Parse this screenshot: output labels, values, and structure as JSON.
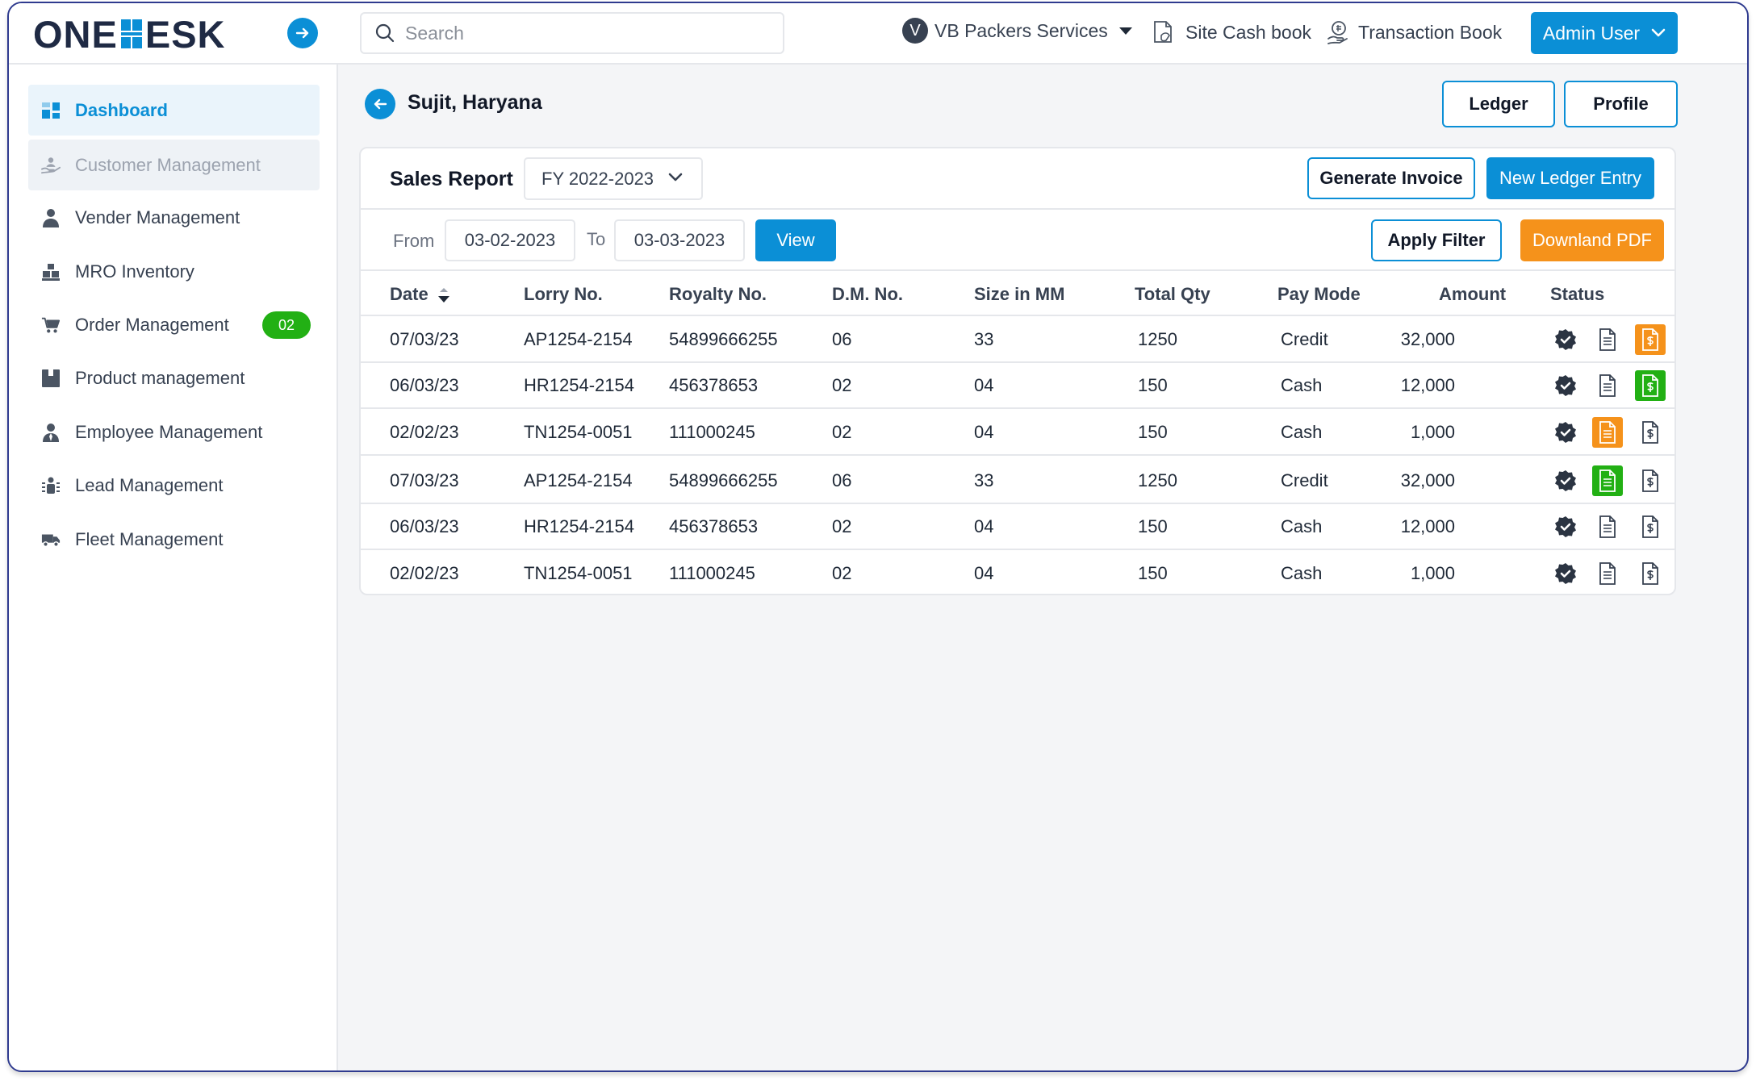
{
  "app": {
    "logo_text_left": "ONE",
    "logo_text_right": "ESK"
  },
  "header": {
    "search_placeholder": "Search",
    "company_initial": "V",
    "company_name": "VB Packers Services",
    "site_cash_book": "Site Cash book",
    "transaction_book": "Transaction Book",
    "admin_user": "Admin User"
  },
  "sidebar": {
    "items": [
      {
        "label": "Dashboard",
        "icon": "dashboard-icon",
        "state": "active"
      },
      {
        "label": "Customer Management",
        "icon": "customer-icon",
        "state": "hover"
      },
      {
        "label": "Vender Management",
        "icon": "person-icon",
        "state": "normal"
      },
      {
        "label": "MRO Inventory",
        "icon": "inventory-icon",
        "state": "normal"
      },
      {
        "label": "Order Management",
        "icon": "cart-icon",
        "state": "normal",
        "badge": "02"
      },
      {
        "label": "Product management",
        "icon": "product-icon",
        "state": "normal"
      },
      {
        "label": "Employee Management",
        "icon": "employee-icon",
        "state": "normal"
      },
      {
        "label": "Lead Management",
        "icon": "lead-icon",
        "state": "normal"
      },
      {
        "label": "Fleet Management",
        "icon": "truck-icon",
        "state": "normal"
      }
    ]
  },
  "page": {
    "title": "Sujit, Haryana",
    "ledger_label": "Ledger",
    "profile_label": "Profile"
  },
  "report": {
    "title": "Sales Report",
    "fy_selected": "FY 2022-2023",
    "generate_invoice": "Generate Invoice",
    "new_ledger_entry": "New Ledger Entry",
    "from_label": "From",
    "from_value": "03-02-2023",
    "to_label": "To",
    "to_value": "03-03-2023",
    "view_label": "View",
    "apply_filter": "Apply Filter",
    "download_pdf": "Downland PDF"
  },
  "table": {
    "columns": [
      "Date",
      "Lorry No.",
      "Royalty No.",
      "D.M. No.",
      "Size in MM",
      "Total Qty",
      "Pay Mode",
      "Amount",
      "Status"
    ],
    "rows": [
      {
        "date": "07/03/23",
        "lorry": "AP1254-2154",
        "royalty": "54899666255",
        "dm": "06",
        "size": "33",
        "qty": "1250",
        "pay": "Credit",
        "amount": "32,000",
        "doc_state": "plain",
        "invoice_state": "orange"
      },
      {
        "date": "06/03/23",
        "lorry": "HR1254-2154",
        "royalty": "456378653",
        "dm": "02",
        "size": "04",
        "qty": "150",
        "pay": "Cash",
        "amount": "12,000",
        "doc_state": "plain",
        "invoice_state": "green"
      },
      {
        "date": "02/02/23",
        "lorry": "TN1254-0051",
        "royalty": "111000245",
        "dm": "02",
        "size": "04",
        "qty": "150",
        "pay": "Cash",
        "amount": "1,000",
        "doc_state": "orange",
        "invoice_state": "plain"
      },
      {
        "date": "07/03/23",
        "lorry": "AP1254-2154",
        "royalty": "54899666255",
        "dm": "06",
        "size": "33",
        "qty": "1250",
        "pay": "Credit",
        "amount": "32,000",
        "doc_state": "green",
        "invoice_state": "plain"
      },
      {
        "date": "06/03/23",
        "lorry": "HR1254-2154",
        "royalty": "456378653",
        "dm": "02",
        "size": "04",
        "qty": "150",
        "pay": "Cash",
        "amount": "12,000",
        "doc_state": "plain",
        "invoice_state": "plain"
      },
      {
        "date": "02/02/23",
        "lorry": "TN1254-0051",
        "royalty": "111000245",
        "dm": "02",
        "size": "04",
        "qty": "150",
        "pay": "Cash",
        "amount": "1,000",
        "doc_state": "plain",
        "invoice_state": "plain"
      }
    ]
  },
  "colors": {
    "accent": "#0b8fd6",
    "orange": "#f5921b",
    "green": "#22b014",
    "badge_dark": "#2b3442"
  }
}
